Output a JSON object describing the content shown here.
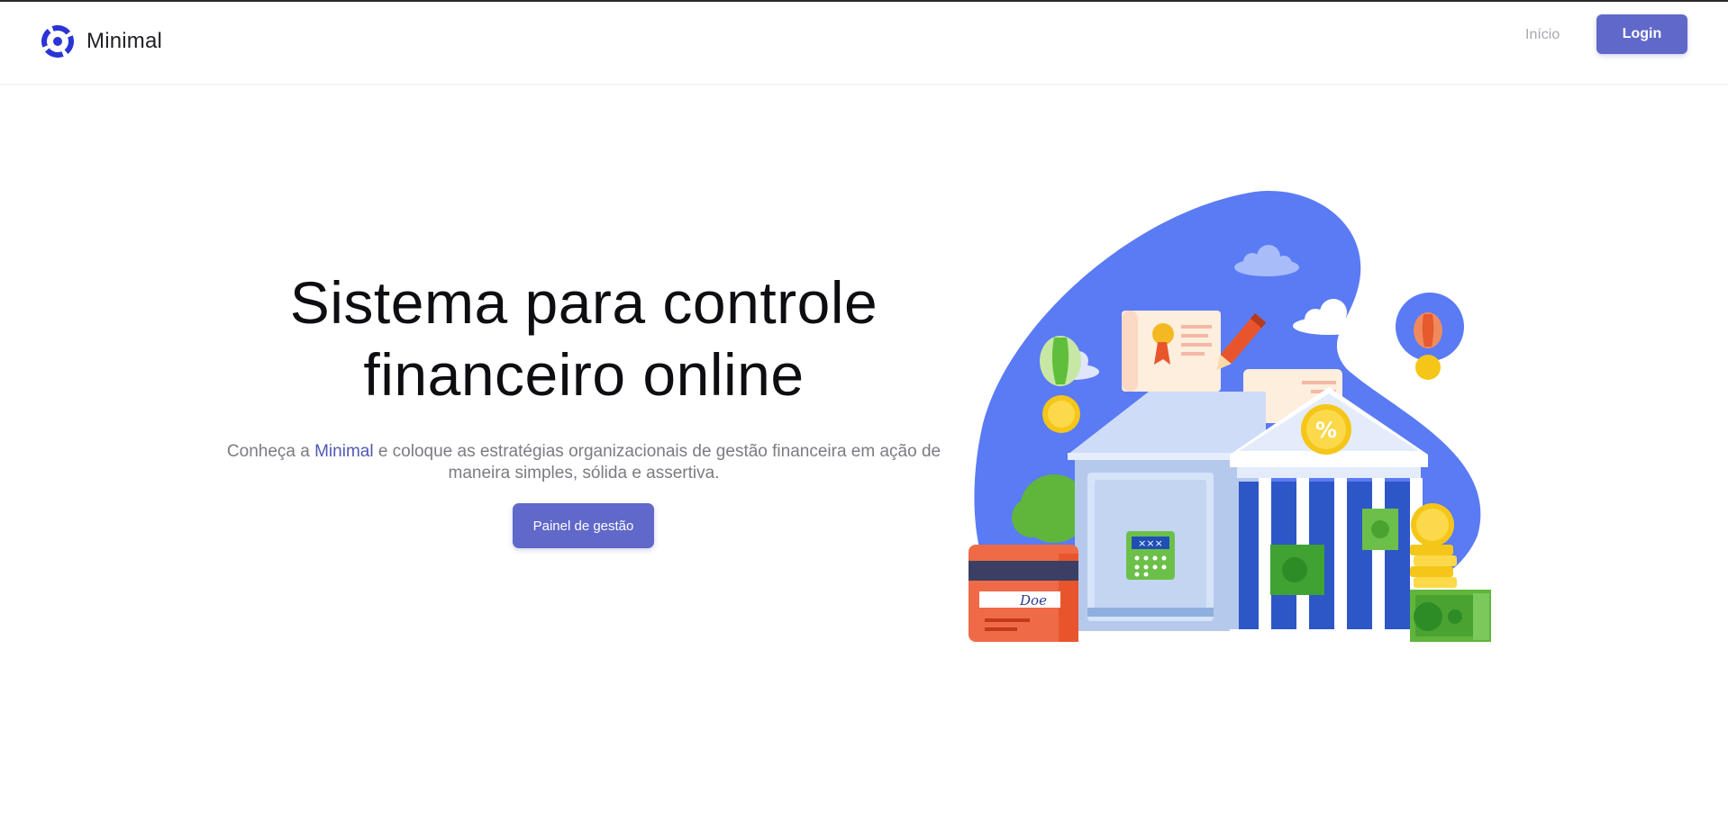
{
  "navbar": {
    "brand_name": "Minimal",
    "links": [
      {
        "label": "Início"
      }
    ],
    "login_label": "Login"
  },
  "hero": {
    "title_line1": "Sistema para controle",
    "title_line2": "financeiro online",
    "subtitle_before": "Conheça a ",
    "subtitle_brand": "Minimal",
    "subtitle_after": " e coloque as estratégias organizacionais de gestão financeira em ação de maneira simples, sólida e assertiva.",
    "cta_label": "Painel de gestão"
  },
  "illustration": {
    "card_signature": "Doe",
    "coin_symbol": "%",
    "safe_display": "×××"
  },
  "colors": {
    "accent": "#6068c9",
    "brand_highlight": "#5058b4",
    "logo_blue": "#2b34d6",
    "blob_blue": "#5a7bf4"
  }
}
